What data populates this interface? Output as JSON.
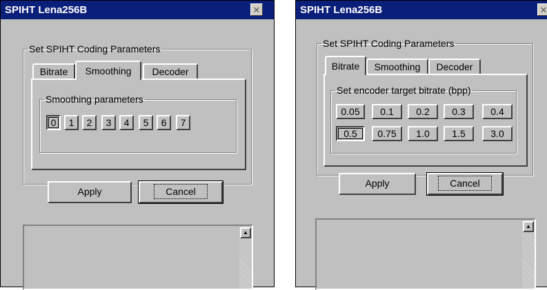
{
  "window1": {
    "title": "SPIHT  Lena256B",
    "close_glyph": "✕",
    "group_legend": "Set SPIHT Coding Parameters",
    "tabs": [
      {
        "label": "Bitrate"
      },
      {
        "label": "Smoothing"
      },
      {
        "label": "Decoder"
      }
    ],
    "active_tab": "Smoothing",
    "subgroup_legend": "Smoothing parameters",
    "values": [
      "0",
      "1",
      "2",
      "3",
      "4",
      "5",
      "6",
      "7"
    ],
    "selected_value": "0",
    "apply_label": "Apply",
    "cancel_label": "Cancel",
    "scroll_up_glyph": "▲"
  },
  "window2": {
    "title": "SPIHT  Lena256B",
    "close_glyph": "✕",
    "group_legend": "Set SPIHT Coding Parameters",
    "tabs": [
      {
        "label": "Bitrate"
      },
      {
        "label": "Smoothing"
      },
      {
        "label": "Decoder"
      }
    ],
    "active_tab": "Bitrate",
    "subgroup_legend": "Set encoder target bitrate (bpp)",
    "row1": [
      "0.05",
      "0.1",
      "0.2",
      "0.3",
      "0.4"
    ],
    "row2": [
      "0.5",
      "0.75",
      "1.0",
      "1.5",
      "3.0"
    ],
    "selected_value": "0.5",
    "apply_label": "Apply",
    "cancel_label": "Cancel",
    "scroll_up_glyph": "▲"
  },
  "colors": {
    "titlebar": "#0a1f7a",
    "face": "#c0c0c0"
  }
}
